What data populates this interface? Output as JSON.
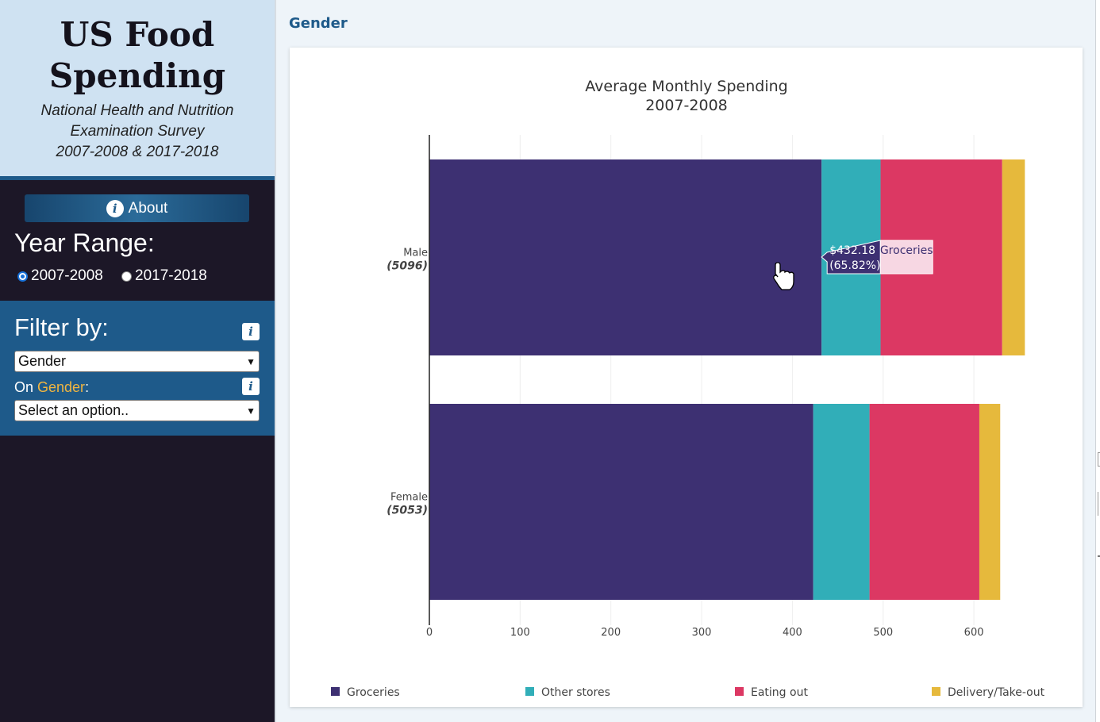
{
  "sidebar": {
    "title": "US Food Spending",
    "subtitle_lines": [
      "National Health and Nutrition",
      "Examination Survey",
      "2007-2008 & 2017-2018"
    ],
    "about_label": "About",
    "year_range_label": "Year Range:",
    "year_options": [
      {
        "label": "2007-2008",
        "checked": true
      },
      {
        "label": "2017-2018",
        "checked": false
      }
    ],
    "filter_label": "Filter by:",
    "filter_select_value": "Gender",
    "on_prefix": "On ",
    "on_field": "Gender",
    "on_suffix": ":",
    "option_select_value": "Select an option..",
    "info_glyph": "i"
  },
  "main": {
    "section_title": "Gender"
  },
  "chart_data": {
    "type": "bar",
    "orientation": "horizontal",
    "stacked": true,
    "title_lines": [
      "Average Monthly Spending",
      "2007-2008"
    ],
    "categories": [
      {
        "label": "Male",
        "count": "(5096)"
      },
      {
        "label": "Female",
        "count": "(5053)"
      }
    ],
    "series": [
      {
        "name": "Groceries",
        "color": "#3d3072",
        "values": [
          432.18,
          423
        ]
      },
      {
        "name": "Other stores",
        "color": "#31aeb8",
        "values": [
          65,
          62
        ]
      },
      {
        "name": "Eating out",
        "color": "#dc3863",
        "values": [
          134,
          121
        ]
      },
      {
        "name": "Delivery/Take-out",
        "color": "#e6b93c",
        "values": [
          25,
          23
        ]
      }
    ],
    "xlim": [
      0,
      660
    ],
    "xticks": [
      0,
      100,
      200,
      300,
      400,
      500,
      600
    ],
    "grid": true,
    "legend_position": "bottom",
    "tooltip": {
      "category_index": 0,
      "series_index": 0,
      "value_text": "$432.18",
      "percent_text": "(65.82%)",
      "series_label": "Groceries"
    }
  }
}
